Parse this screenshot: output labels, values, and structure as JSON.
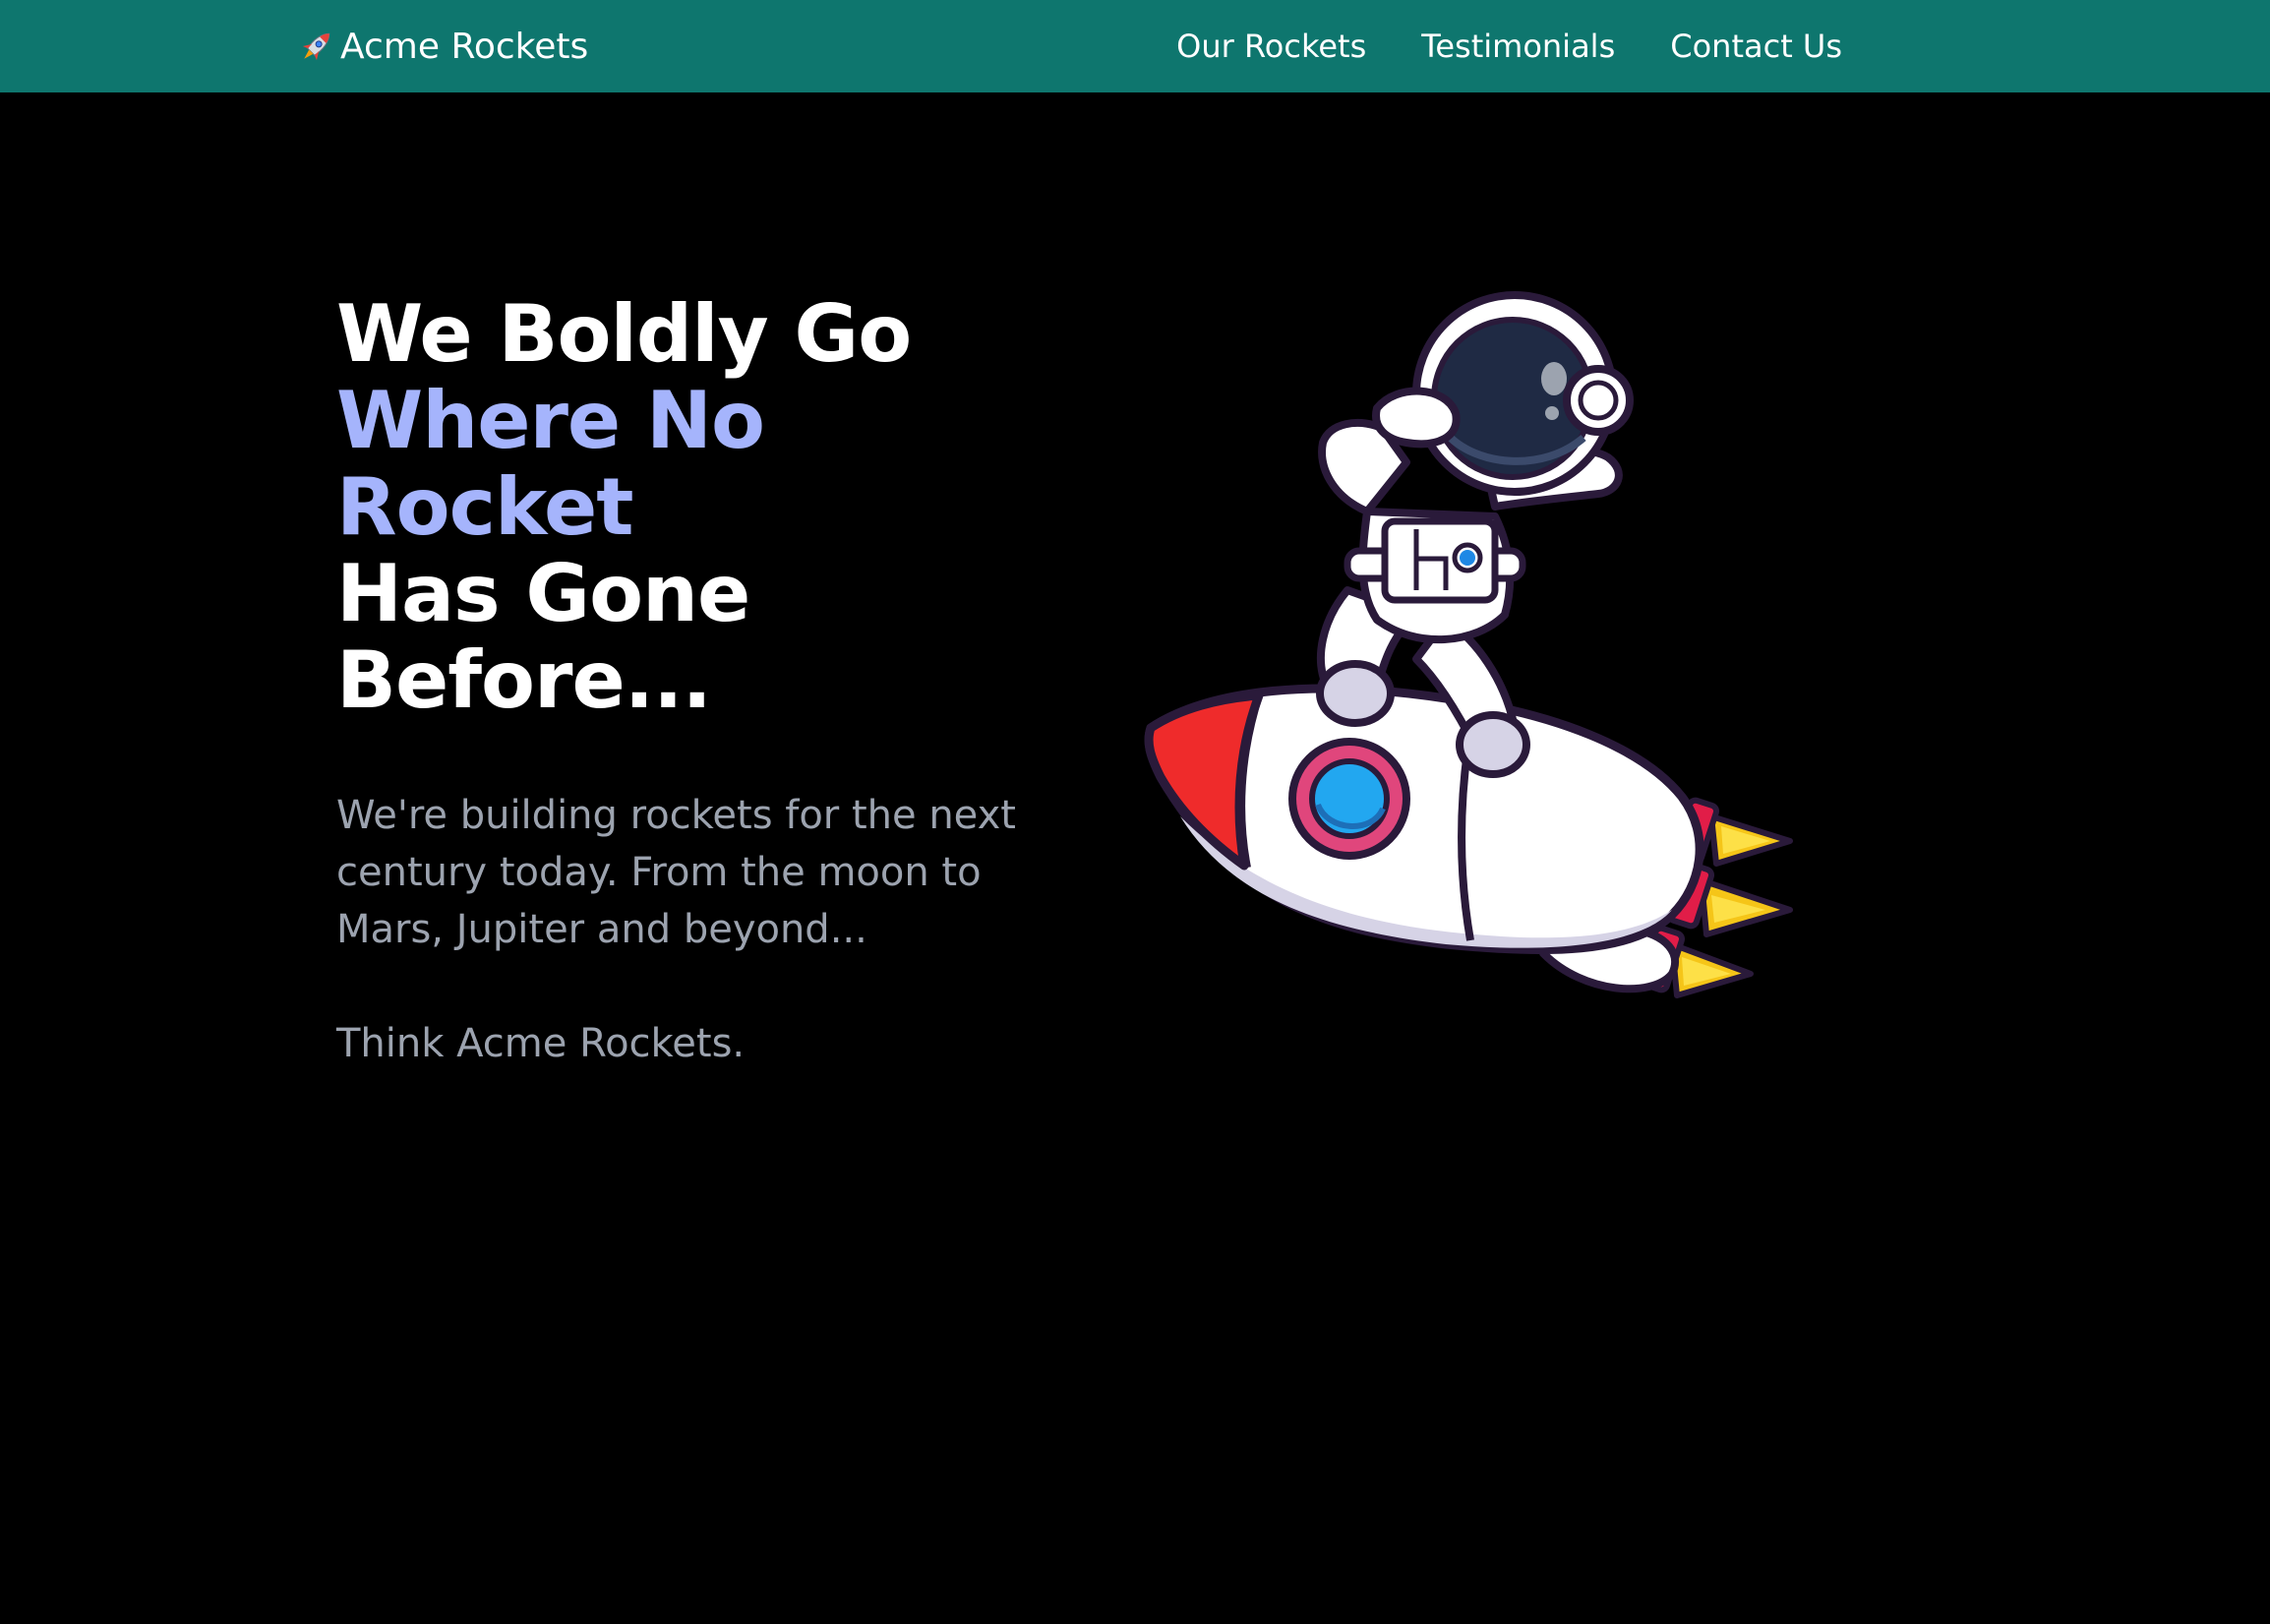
{
  "brand": {
    "name": "Acme Rockets",
    "icon": "rocket-icon"
  },
  "nav": {
    "links": [
      {
        "label": "Our Rockets"
      },
      {
        "label": "Testimonials"
      },
      {
        "label": "Contact Us"
      }
    ]
  },
  "hero": {
    "title_line1": "We Boldly Go",
    "title_accent": "Where No Rocket",
    "title_line3": "Has Gone",
    "title_line4": "Before...",
    "description": "We're building rockets for the next century today. From the moon to Mars, Jupiter and beyond...",
    "tagline": "Think Acme Rockets."
  },
  "colors": {
    "navbar": "#0e766e",
    "background": "#000000",
    "accent": "#a5b4fc",
    "muted_text": "#9ca3af"
  }
}
